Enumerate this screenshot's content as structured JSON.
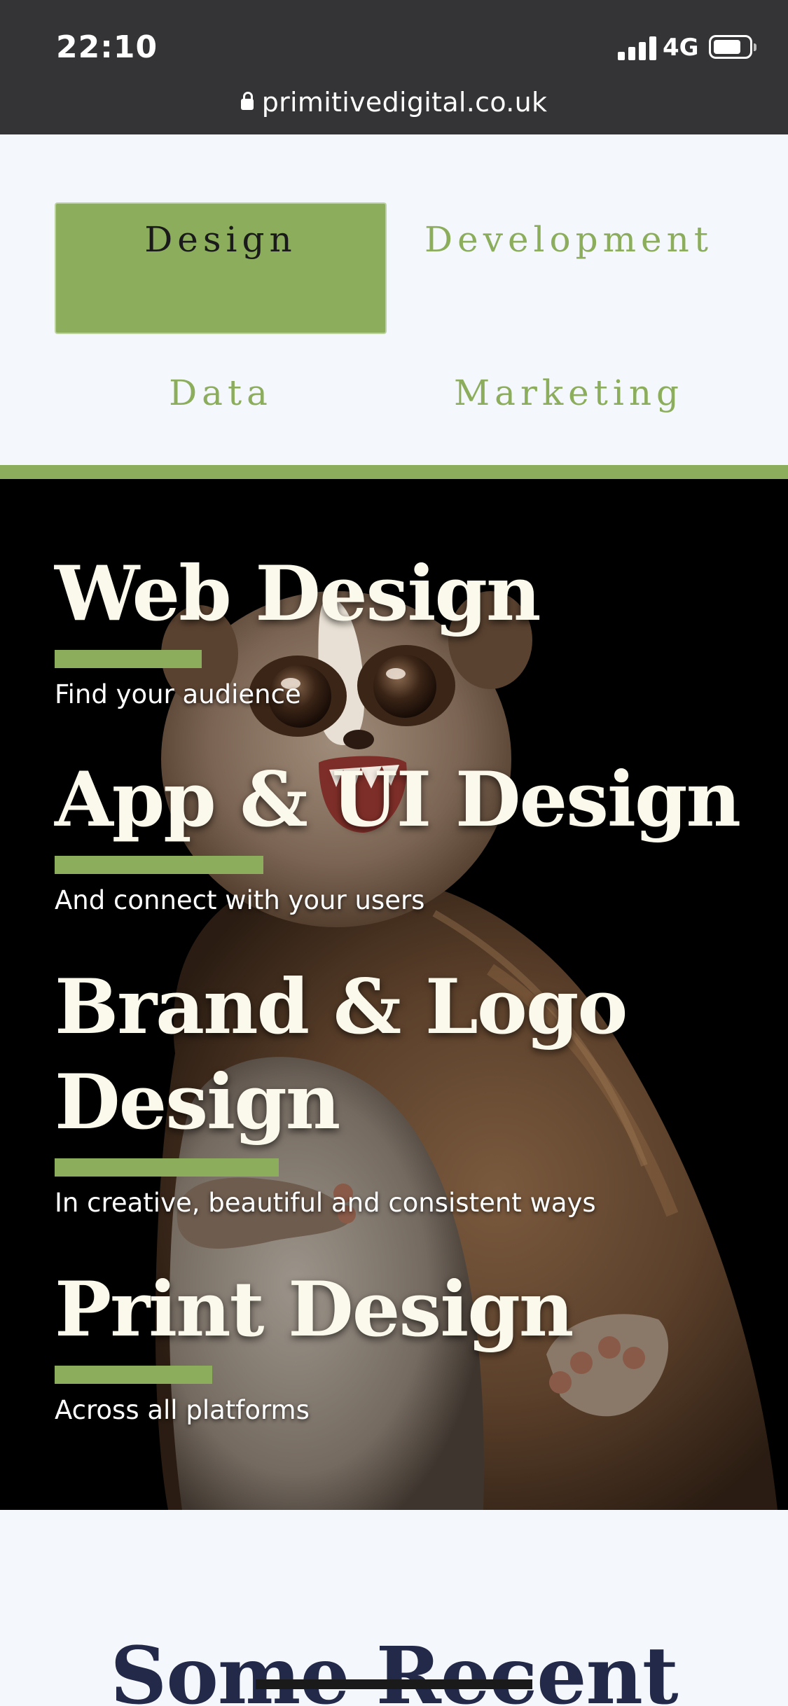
{
  "status_bar": {
    "time": "22:10",
    "network": "4G",
    "battery_level": 0.8
  },
  "browser": {
    "url": "primitivedigital.co.uk"
  },
  "tabs": [
    {
      "label": "Design",
      "active": true
    },
    {
      "label": "Development",
      "active": false
    },
    {
      "label": "Data",
      "active": false
    },
    {
      "label": "Marketing",
      "active": false
    }
  ],
  "services": [
    {
      "title": "Web Design",
      "subtitle": "Find your audience"
    },
    {
      "title": "App & UI Design",
      "subtitle": "And connect with your users"
    },
    {
      "title": "Brand & Logo Design",
      "subtitle": "In creative, beautiful and consistent ways"
    },
    {
      "title": "Print Design",
      "subtitle": "Across all platforms"
    }
  ],
  "recent": {
    "heading": "Some Recent"
  },
  "colors": {
    "accent": "#8bad5c",
    "topbar": "#343436",
    "hero_bg": "#000000",
    "heading_dark": "#232948",
    "page_bg": "#f4f7fb"
  }
}
